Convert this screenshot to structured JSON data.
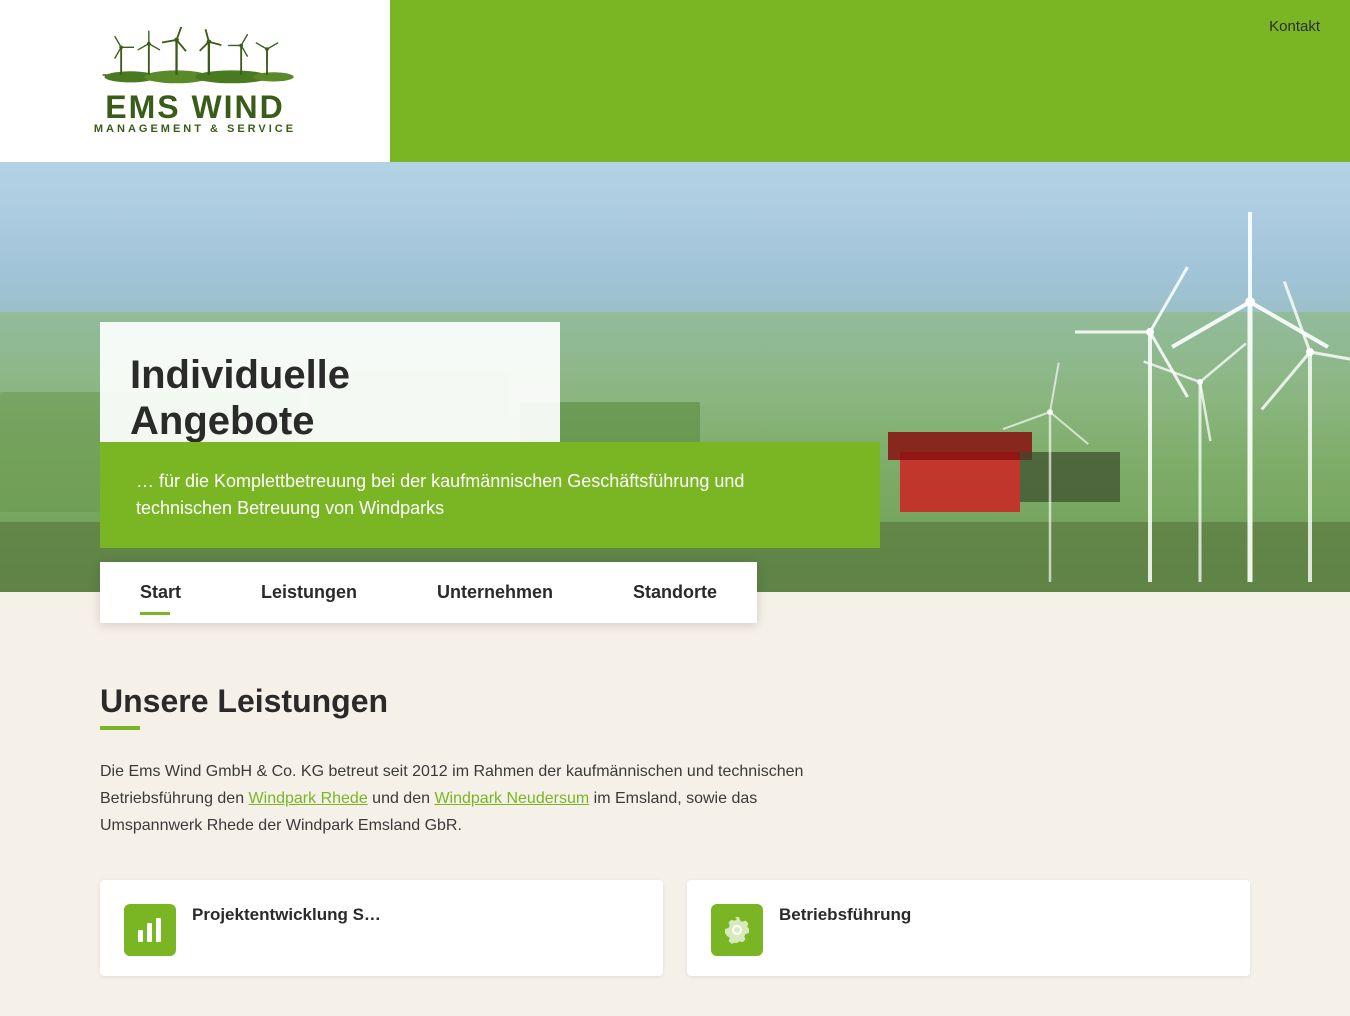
{
  "header": {
    "logo_brand": "EMS WIND",
    "logo_sub": "MANAGEMENT & SERVICE",
    "kontakt_label": "Kontakt"
  },
  "hero": {
    "title": "Individuelle Angebote",
    "subtitle": "… für die Komplettbetreuung bei der kaufmännischen Geschäftsführung und technischen Betreuung von Windparks"
  },
  "nav": {
    "items": [
      {
        "label": "Start",
        "active": true
      },
      {
        "label": "Leistungen",
        "active": false
      },
      {
        "label": "Unternehmen",
        "active": false
      },
      {
        "label": "Standorte",
        "active": false
      }
    ]
  },
  "leistungen": {
    "title": "Unsere Leistungen",
    "body_prefix": "Die Ems Wind GmbH & Co. KG betreut seit 2012 im Rahmen der kaufmännischen und technischen Betriebsführung den ",
    "link1_text": "Windpark Rhede",
    "body_mid": " und den ",
    "link2_text": "Windpark Neudersum",
    "body_suffix": " im Emsland, sowie das Umspannwerk Rhede der Windpark Emsland GbR."
  },
  "cards": [
    {
      "title": "Projektentwicklung S…",
      "icon": "chart-icon"
    },
    {
      "title": "Betriebsführung",
      "icon": "gear-icon"
    }
  ],
  "colors": {
    "green": "#7ab623",
    "dark": "#2a2a2a",
    "bg": "#f5f0e8"
  }
}
